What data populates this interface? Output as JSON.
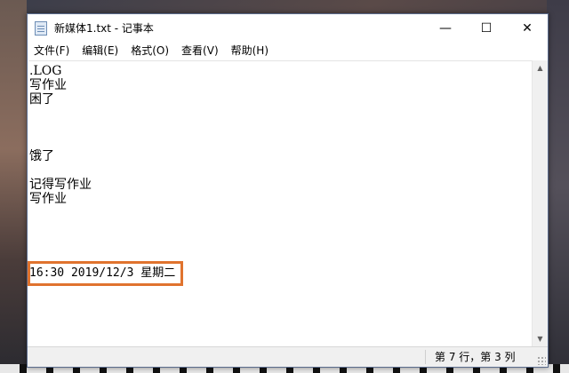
{
  "window": {
    "title": "新媒体1.txt - 记事本",
    "icon": "notepad-icon",
    "controls": {
      "minimize": "—",
      "maximize": "☐",
      "close": "✕"
    }
  },
  "menu": {
    "items": [
      {
        "label": "文件(F)"
      },
      {
        "label": "编辑(E)"
      },
      {
        "label": "格式(O)"
      },
      {
        "label": "查看(V)"
      },
      {
        "label": "帮助(H)"
      }
    ]
  },
  "document": {
    "lines": [
      ".LOG",
      "写作业",
      "困了",
      "",
      "",
      "",
      "饿了",
      "",
      "记得写作业",
      "写作业",
      "",
      "",
      "",
      "",
      "16:30 2019/12/3 星期二"
    ]
  },
  "highlight": {
    "color": "#e0732e"
  },
  "statusbar": {
    "position": "第 7 行，第 3 列"
  }
}
